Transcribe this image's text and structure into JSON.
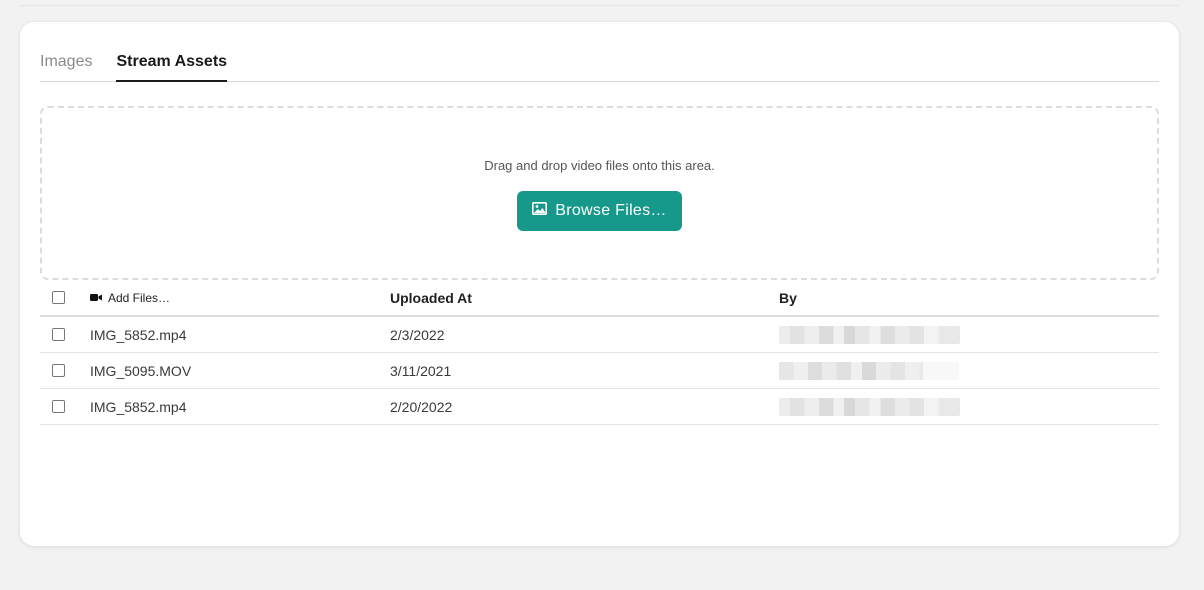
{
  "tabs": [
    {
      "label": "Images",
      "active": false
    },
    {
      "label": "Stream Assets",
      "active": true
    }
  ],
  "dropzone": {
    "instruction": "Drag and drop video files onto this area.",
    "browse_label": "Browse Files…"
  },
  "table": {
    "headers": {
      "add_files": "Add Files…",
      "uploaded_at": "Uploaded At",
      "by": "By"
    },
    "rows": [
      {
        "name": "IMG_5852.mp4",
        "uploaded_at": "2/3/2022",
        "by": ""
      },
      {
        "name": "IMG_5095.MOV",
        "uploaded_at": "3/11/2021",
        "by": ""
      },
      {
        "name": "IMG_5852.mp4",
        "uploaded_at": "2/20/2022",
        "by": ""
      }
    ]
  },
  "colors": {
    "accent": "#16998a",
    "background": "#f2f2f2",
    "card": "#ffffff"
  },
  "icons": {
    "browse": "image-icon",
    "add_files": "video-camera-icon"
  }
}
